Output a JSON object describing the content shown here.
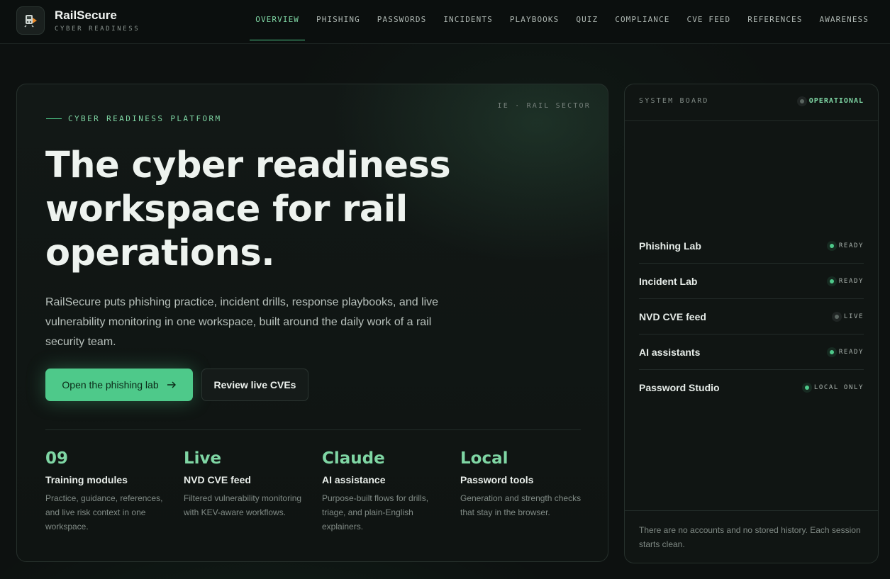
{
  "brand": {
    "name": "RailSecure",
    "tagline": "CYBER READINESS"
  },
  "nav": [
    {
      "label": "OVERVIEW",
      "active": true
    },
    {
      "label": "PHISHING"
    },
    {
      "label": "PASSWORDS"
    },
    {
      "label": "INCIDENTS"
    },
    {
      "label": "PLAYBOOKS"
    },
    {
      "label": "QUIZ"
    },
    {
      "label": "COMPLIANCE"
    },
    {
      "label": "CVE FEED"
    },
    {
      "label": "REFERENCES"
    },
    {
      "label": "AWARENESS"
    }
  ],
  "hero": {
    "eyebrow": "CYBER READINESS PLATFORM",
    "region": "IE · RAIL SECTOR",
    "headline": "The cyber readiness workspace for rail operations.",
    "lede": "RailSecure puts phishing practice, incident drills, response playbooks, and live vulnerability monitoring in one workspace, built around the daily work of a rail security team.",
    "primary_cta": "Open the phishing lab",
    "primary_cta_icon": "arrow-right-icon",
    "secondary_cta": "Review live CVEs",
    "stats": [
      {
        "value": "09",
        "title": "Training modules",
        "desc": "Practice, guidance, references, and live risk context in one workspace."
      },
      {
        "value": "Live",
        "title": "NVD CVE feed",
        "desc": "Filtered vulnerability monitoring with KEV-aware workflows."
      },
      {
        "value": "Claude",
        "title": "AI assistance",
        "desc": "Purpose-built flows for drills, triage, and plain-English explainers."
      },
      {
        "value": "Local",
        "title": "Password tools",
        "desc": "Generation and strength checks that stay in the browser."
      }
    ]
  },
  "board": {
    "title": "SYSTEM BOARD",
    "status": "OPERATIONAL",
    "rows": [
      {
        "name": "Phishing Lab",
        "status": "READY",
        "state": "ready"
      },
      {
        "name": "Incident Lab",
        "status": "READY",
        "state": "ready"
      },
      {
        "name": "NVD CVE feed",
        "status": "LIVE",
        "state": "gray"
      },
      {
        "name": "AI assistants",
        "status": "READY",
        "state": "ready"
      },
      {
        "name": "Password Studio",
        "status": "LOCAL ONLY",
        "state": "ready"
      }
    ],
    "footer": "There are no accounts and no stored history. Each session starts clean."
  },
  "colors": {
    "accent": "#4ec98a",
    "accent_text": "#7fd6a4",
    "background": "#0d1110"
  }
}
